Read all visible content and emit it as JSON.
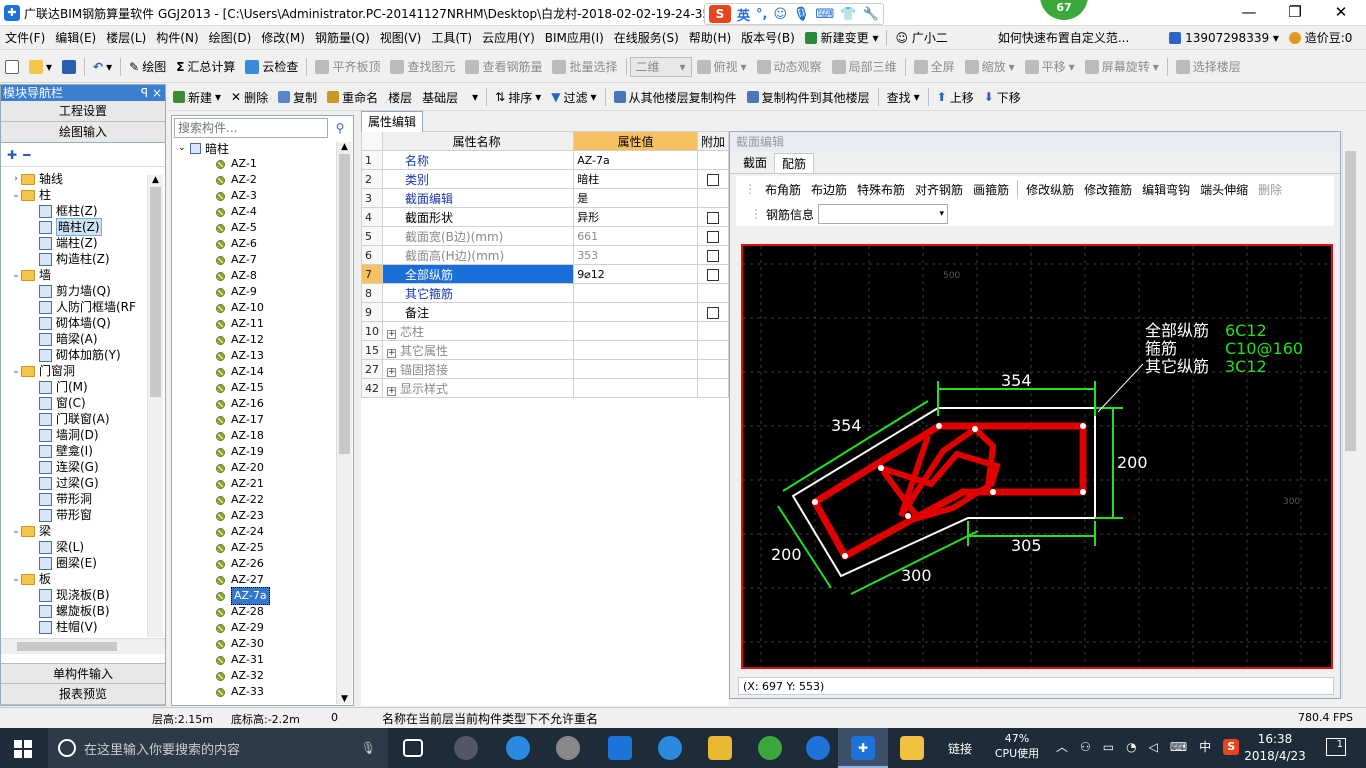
{
  "window": {
    "title": "广联达BIM钢筋算量软件 GGJ2013 - [C:\\Users\\Administrator.PC-20141127NRHM\\Desktop\\白龙村-2018-02-02-19-24-35",
    "ime_label": "英",
    "badge": "67",
    "min": "—",
    "max": "❐",
    "close": "✕"
  },
  "menu": {
    "items": [
      "文件(F)",
      "编辑(E)",
      "楼层(L)",
      "构件(N)",
      "绘图(D)",
      "修改(M)",
      "钢筋量(Q)",
      "视图(V)",
      "工具(T)",
      "云应用(Y)",
      "BIM应用(I)",
      "在线服务(S)",
      "帮助(H)",
      "版本号(B)"
    ],
    "change_label": "新建变更",
    "assistant_label": "广小二",
    "question": "如何快速布置自定义范...",
    "phone": "13907298339",
    "price": "造价豆:0"
  },
  "toolbar1": {
    "draw": "绘图",
    "sum": "汇总计算",
    "cloud": "云检查",
    "flush": "平齐板顶",
    "find": "查找图元",
    "view_steel": "查看钢筋量",
    "batch": "批量选择",
    "view_mode": "二维",
    "top_view": "俯视",
    "dyn_view": "动态观察",
    "local3d": "局部三维",
    "full": "全屏",
    "zoom": "缩放",
    "pan": "平移",
    "rotate": "屏幕旋转",
    "select_floor": "选择楼层"
  },
  "toolbar2": {
    "new": "新建",
    "delete": "删除",
    "copy": "复制",
    "rename": "重命名",
    "floor": "楼层",
    "floor_value": "基础层",
    "sort": "排序",
    "filter": "过滤",
    "copy_from": "从其他楼层复制构件",
    "copy_to": "复制构件到其他楼层",
    "find": "查找",
    "up": "上移",
    "down": "下移"
  },
  "nav": {
    "header": "模块导航栏",
    "pin": "ꟼ ×",
    "settings": "工程设置",
    "drawing": "绘图输入",
    "single": "单构件输入",
    "report": "报表预览",
    "tree": [
      {
        "label": "轴线",
        "level": 0,
        "folder": true,
        "exp": "›"
      },
      {
        "label": "柱",
        "level": 0,
        "folder": true,
        "exp": "⌄"
      },
      {
        "label": "框柱(Z)",
        "level": 1
      },
      {
        "label": "暗柱(Z)",
        "level": 1,
        "selected": true
      },
      {
        "label": "端柱(Z)",
        "level": 1
      },
      {
        "label": "构造柱(Z)",
        "level": 1
      },
      {
        "label": "墙",
        "level": 0,
        "folder": true,
        "exp": "⌄"
      },
      {
        "label": "剪力墙(Q)",
        "level": 1
      },
      {
        "label": "人防门框墙(RF",
        "level": 1
      },
      {
        "label": "砌体墙(Q)",
        "level": 1
      },
      {
        "label": "暗梁(A)",
        "level": 1
      },
      {
        "label": "砌体加筋(Y)",
        "level": 1
      },
      {
        "label": "门窗洞",
        "level": 0,
        "folder": true,
        "exp": "⌄"
      },
      {
        "label": "门(M)",
        "level": 1
      },
      {
        "label": "窗(C)",
        "level": 1
      },
      {
        "label": "门联窗(A)",
        "level": 1
      },
      {
        "label": "墙洞(D)",
        "level": 1
      },
      {
        "label": "壁龛(I)",
        "level": 1
      },
      {
        "label": "连梁(G)",
        "level": 1
      },
      {
        "label": "过梁(G)",
        "level": 1
      },
      {
        "label": "带形洞",
        "level": 1
      },
      {
        "label": "带形窗",
        "level": 1
      },
      {
        "label": "梁",
        "level": 0,
        "folder": true,
        "exp": "⌄"
      },
      {
        "label": "梁(L)",
        "level": 1
      },
      {
        "label": "圈梁(E)",
        "level": 1
      },
      {
        "label": "板",
        "level": 0,
        "folder": true,
        "exp": "⌄"
      },
      {
        "label": "现浇板(B)",
        "level": 1
      },
      {
        "label": "螺旋板(B)",
        "level": 1
      },
      {
        "label": "柱帽(V)",
        "level": 1
      }
    ]
  },
  "complist": {
    "search_placeholder": "搜索构件...",
    "root": "暗柱",
    "items": [
      "AZ-1",
      "AZ-2",
      "AZ-3",
      "AZ-4",
      "AZ-5",
      "AZ-6",
      "AZ-7",
      "AZ-8",
      "AZ-9",
      "AZ-10",
      "AZ-11",
      "AZ-12",
      "AZ-13",
      "AZ-14",
      "AZ-15",
      "AZ-16",
      "AZ-17",
      "AZ-18",
      "AZ-19",
      "AZ-20",
      "AZ-21",
      "AZ-22",
      "AZ-23",
      "AZ-24",
      "AZ-25",
      "AZ-26",
      "AZ-27",
      "AZ-7a",
      "AZ-28",
      "AZ-29",
      "AZ-30",
      "AZ-31",
      "AZ-32",
      "AZ-33"
    ],
    "selected": "AZ-7a"
  },
  "props": {
    "tab": "属性编辑",
    "col_name": "属性名称",
    "col_value": "属性值",
    "col_add": "附加",
    "rows": [
      {
        "num": "1",
        "name": "名称",
        "value": "AZ-7a",
        "style": "blue",
        "cb": false
      },
      {
        "num": "2",
        "name": "类别",
        "value": "暗柱",
        "style": "blue",
        "cb": true
      },
      {
        "num": "3",
        "name": "截面编辑",
        "value": "是",
        "style": "blue",
        "cb": false
      },
      {
        "num": "4",
        "name": "截面形状",
        "value": "异形",
        "style": "",
        "cb": true
      },
      {
        "num": "5",
        "name": "截面宽(B边)(mm)",
        "value": "661",
        "style": "gray",
        "cb": true
      },
      {
        "num": "6",
        "name": "截面高(H边)(mm)",
        "value": "353",
        "style": "gray",
        "cb": true
      },
      {
        "num": "7",
        "name": "全部纵筋",
        "value": "9⌀12",
        "style": "sel",
        "cb": true
      },
      {
        "num": "8",
        "name": "其它箍筋",
        "value": "",
        "style": "blue",
        "cb": false
      },
      {
        "num": "9",
        "name": "备注",
        "value": "",
        "style": "",
        "cb": true
      },
      {
        "num": "10",
        "name": "芯柱",
        "value": "",
        "style": "gray",
        "group": true
      },
      {
        "num": "15",
        "name": "其它属性",
        "value": "",
        "style": "gray",
        "group": true
      },
      {
        "num": "27",
        "name": "锚固搭接",
        "value": "",
        "style": "gray",
        "group": true
      },
      {
        "num": "42",
        "name": "显示样式",
        "value": "",
        "style": "gray",
        "group": true
      }
    ]
  },
  "section": {
    "title": "截面编辑",
    "tabs": [
      "截面",
      "配筋"
    ],
    "active_tab": "配筋",
    "tools": [
      "布角筋",
      "布边筋",
      "特殊布筋",
      "对齐钢筋",
      "画箍筋",
      "修改纵筋",
      "修改箍筋",
      "编辑弯钩",
      "端头伸缩",
      "删除"
    ],
    "steel_info_label": "钢筋信息",
    "coords": "(X: 697 Y: 553)",
    "annot": {
      "l1": "全部纵筋",
      "v1": "6C12",
      "l2": "箍筋",
      "v2": "C10@160",
      "l3": "其它纵筋",
      "v3": "3C12"
    },
    "dims": {
      "top": "354",
      "left_top": "354",
      "right": "200",
      "bottom_right": "305",
      "bottom": "300",
      "left": "200"
    },
    "grid_labels": {
      "g500": "500",
      "g300": "300"
    },
    "colors": {
      "rebar": "#e00000",
      "dim": "#20e020",
      "outline": "#ffffff"
    }
  },
  "status": {
    "floor_height": "层高:2.15m",
    "bottom_height": "底标高:-2.2m",
    "zero": "0",
    "message": "名称在当前层当前构件类型下不允许重名",
    "fps": "780.4 FPS"
  },
  "taskbar": {
    "search_placeholder": "在这里输入你要搜索的内容",
    "link": "链接",
    "cpu_pct": "47%",
    "cpu_label": "CPU使用",
    "lang": "中",
    "time": "16:38",
    "date": "2018/4/23",
    "notif": "1"
  }
}
